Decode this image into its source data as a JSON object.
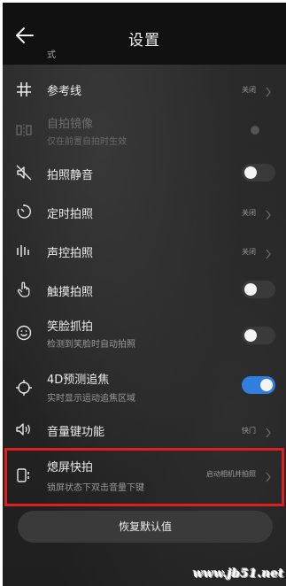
{
  "header": {
    "title": "设置",
    "clipped_text": "式"
  },
  "rows": [
    {
      "label": "参考线",
      "value": "关闭",
      "icon": "grid-icon",
      "control": "chevron"
    },
    {
      "label": "自拍镜像",
      "sub": "仅在前置自拍时生效",
      "icon": "mirror-icon",
      "control": "disabled-dot",
      "disabled": true
    },
    {
      "label": "拍照静音",
      "icon": "mute-icon",
      "control": "toggle",
      "on": false
    },
    {
      "label": "定时拍照",
      "value": "关闭",
      "icon": "timer-icon",
      "control": "chevron"
    },
    {
      "label": "声控拍照",
      "value": "关闭",
      "icon": "audio-bars-icon",
      "control": "chevron"
    },
    {
      "label": "触摸拍照",
      "icon": "touch-hand-icon",
      "control": "toggle",
      "on": false
    },
    {
      "label": "笑脸抓拍",
      "sub": "检测到笑脸时自动拍照",
      "icon": "smile-icon",
      "control": "toggle",
      "on": false
    },
    {
      "label": "4D预测追焦",
      "sub": "实时显示运动追焦区域",
      "icon": "focus-target-icon",
      "control": "toggle",
      "on": true
    },
    {
      "label": "音量键功能",
      "value": "快门",
      "icon": "volume-icon",
      "control": "chevron"
    },
    {
      "label": "熄屏快拍",
      "sub": "锁屏状态下双击音量下键",
      "value": "启动相机并拍照",
      "icon": "screen-off-snap-icon",
      "control": "chevron"
    }
  ],
  "reset_button": "恢复默认值",
  "watermark": "www.jb51.net",
  "colors": {
    "toggle_on": "#2f7fe0",
    "highlight_border": "#e11e1e"
  }
}
